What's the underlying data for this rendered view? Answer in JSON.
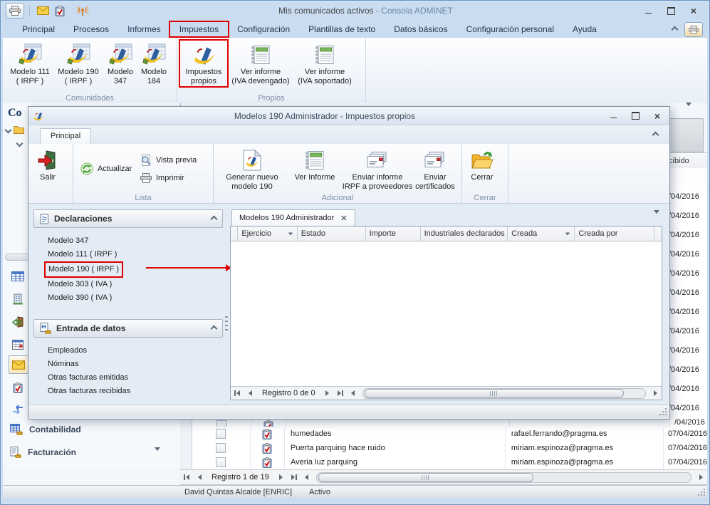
{
  "main": {
    "titlebar": {
      "title": "Mis comunicados activos",
      "app": "- Consola ADMINET"
    },
    "menu": {
      "items": [
        "Principal",
        "Procesos",
        "Informes",
        "Impuestos",
        "Configuración",
        "Plantillas de texto",
        "Datos básicos",
        "Configuración personal",
        "Ayuda"
      ]
    },
    "ribbon": {
      "group1_label": "Comunidades",
      "group2_label": "Propios",
      "btn_m111_1": "Modelo 111",
      "btn_m111_2": "( IRPF )",
      "btn_m190_1": "Modelo 190",
      "btn_m190_2": "( IRPF )",
      "btn_m347_1": "Modelo",
      "btn_m347_2": "347",
      "btn_m184_1": "Modelo",
      "btn_m184_2": "184",
      "btn_prop_1": "Impuestos",
      "btn_prop_2": "propios",
      "btn_dev_1": "Ver informe",
      "btn_dev_2": "(IVA devengado)",
      "btn_sop_1": "Ver informe",
      "btn_sop_2": "(IVA soportado)"
    },
    "navpane": {
      "header": "Co",
      "item_contabilidad": "Contabilidad",
      "item_facturacion": "Facturación"
    },
    "bg_table": {
      "header_partial": "cibido",
      "sliver_date": "/04/2016",
      "rows": [
        {
          "subject": "humedades",
          "email": "rafael.ferrando@pragma.es",
          "date": "07/04/2016"
        },
        {
          "subject": "Puerta parquing hace ruido",
          "email": "miriam.espinoza@pragma.es",
          "date": "07/04/2016"
        },
        {
          "subject": "Averia luz parquing",
          "email": "miriam.espinoza@pragma.es",
          "date": "07/04/2016"
        }
      ]
    },
    "navigator": {
      "label": "Registro 1 de 19"
    },
    "statusbar": {
      "user": "David Quintas Alcalde [ENRIC]",
      "state": "Activo"
    }
  },
  "dialog": {
    "title": "Modelos 190 Administrador - Impuestos propios",
    "tab": "Principal",
    "ribbon": {
      "salir": "Salir",
      "actualizar": "Actualizar",
      "vista_previa": "Vista previa",
      "imprimir": "Imprimir",
      "lista_label": "Lista",
      "generar_1": "Generar nuevo",
      "generar_2": "modelo 190",
      "ver_informe": "Ver Informe",
      "enviar_informe_1": "Enviar informe",
      "enviar_informe_2": "IRPF a proveedores",
      "enviar_cert_1": "Enviar",
      "enviar_cert_2": "certificados",
      "adicional_label": "Adicional",
      "cerrar": "Cerrar",
      "cerrar_label": "Cerrar"
    },
    "declaraciones": {
      "title": "Declaraciones",
      "items": [
        "Modelo 347",
        "Modelo 111 ( IRPF )",
        "Modelo 190 ( IRPF )",
        "Modelo 303 ( IVA )",
        "Modelo 390 ( IVA )"
      ]
    },
    "entrada": {
      "title": "Entrada de datos",
      "items": [
        "Empleados",
        "Nóminas",
        "Otras facturas emitidas",
        "Otras facturas recibidas"
      ]
    },
    "doc_tab": "Modelos 190 Administrador",
    "grid": {
      "columns": [
        "Ejercicio",
        "Estado",
        "Importe",
        "Industriales declarados",
        "Creada",
        "Creada por"
      ]
    },
    "navigator": {
      "label": "Registro 0 de 0"
    }
  }
}
